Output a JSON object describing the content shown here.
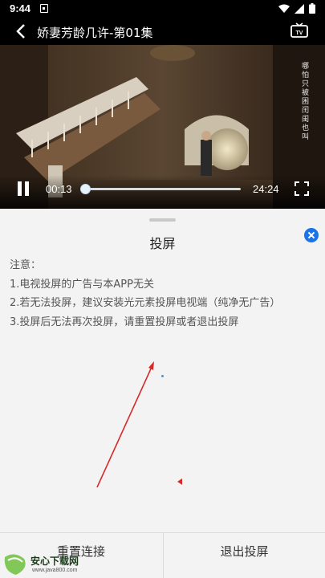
{
  "status_bar": {
    "time": "9:44"
  },
  "header": {
    "title": "娇妻芳龄几许-第01集"
  },
  "video": {
    "caption_vertical": "哪怕只被困闰闺也叫",
    "current_time": "00:13",
    "total_time": "24:24",
    "progress": 0.009
  },
  "sheet": {
    "title": "投屏",
    "notice_heading": "注意：",
    "notices": [
      "1.电视投屏的广告与本APP无关",
      "2.若无法投屏，建议安装光元素投屏电视端（纯净无广告）",
      "3.投屏后无法再次投屏，请重置投屏或者退出投屏"
    ]
  },
  "buttons": {
    "reset": "重置连接",
    "exit": "退出投屏"
  },
  "watermark": {
    "text": "安心下载网",
    "sub": "www.java800.com"
  },
  "colors": {
    "accent": "#1a73e8",
    "arrow": "#d62a2a"
  }
}
